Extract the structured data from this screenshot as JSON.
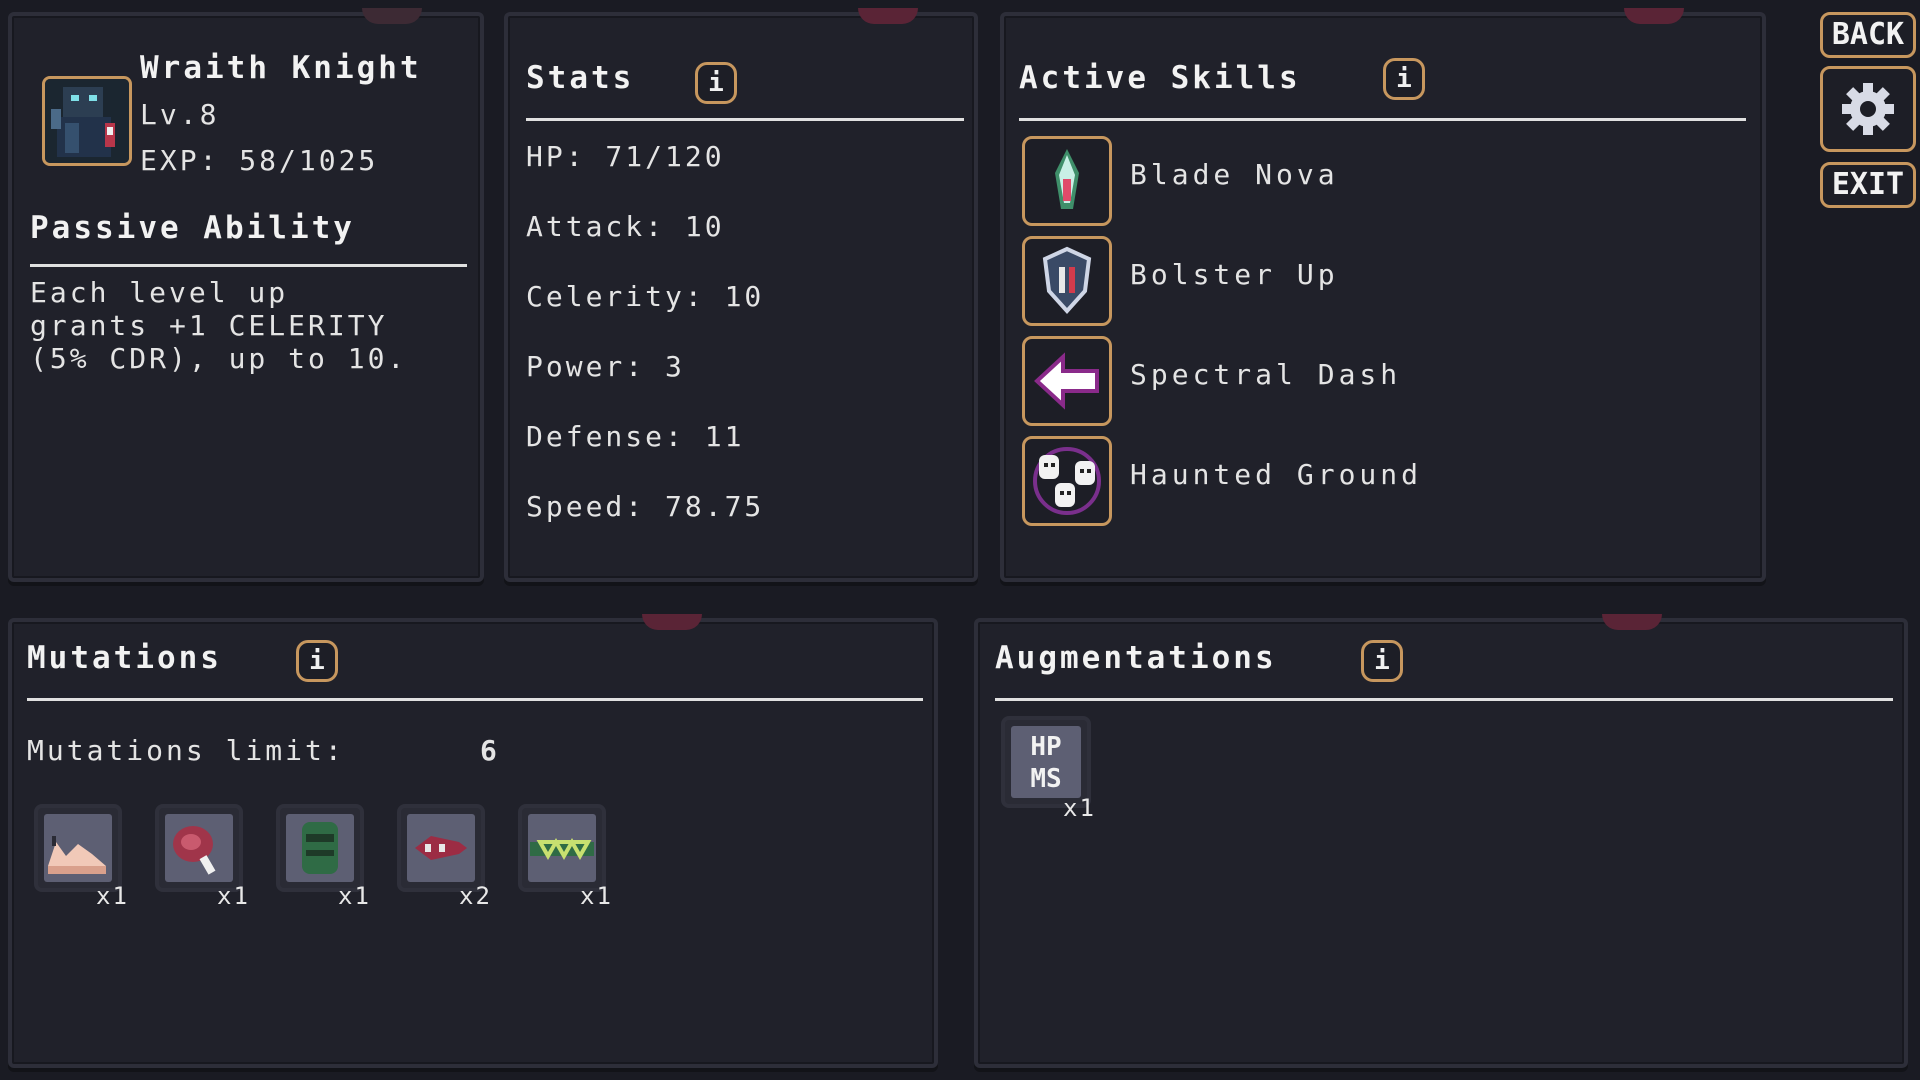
{
  "character": {
    "name": "Wraith Knight",
    "level": "Lv.8",
    "exp": "EXP: 58/1025",
    "passive_heading": "Passive Ability",
    "passive_lines": [
      "Each level up",
      "grants +1 CELERITY",
      "(5% CDR), up to 10."
    ],
    "portrait_icon": "wraith-knight-portrait"
  },
  "stats": {
    "heading": "Stats",
    "info_label": "i",
    "items": [
      "HP: 71/120",
      "Attack: 10",
      "Celerity: 10",
      "Power: 3",
      "Defense: 11",
      "Speed: 78.75"
    ]
  },
  "skills": {
    "heading": "Active Skills",
    "info_label": "i",
    "items": [
      {
        "label": "Blade Nova",
        "icon": "blade-nova-icon"
      },
      {
        "label": "Bolster Up",
        "icon": "shield-icon"
      },
      {
        "label": "Spectral Dash",
        "icon": "arrow-left-icon"
      },
      {
        "label": "Haunted Ground",
        "icon": "ghosts-icon"
      }
    ]
  },
  "mutations": {
    "heading": "Mutations",
    "info_label": "i",
    "limit_label": "Mutations limit:",
    "limit_value": "6",
    "items": [
      {
        "icon": "claw-mutation-icon",
        "count": "x1"
      },
      {
        "icon": "meat-mutation-icon",
        "count": "x1"
      },
      {
        "icon": "goblin-mutation-icon",
        "count": "x1"
      },
      {
        "icon": "fish-mutation-icon",
        "count": "x2"
      },
      {
        "icon": "chain-mutation-icon",
        "count": "x1"
      }
    ]
  },
  "augmentations": {
    "heading": "Augmentations",
    "info_label": "i",
    "items": [
      {
        "line1": "HP",
        "line2": "MS",
        "count": "x1"
      }
    ]
  },
  "side_buttons": {
    "back": "BACK",
    "settings_icon": "gear-icon",
    "exit": "EXIT"
  },
  "colors": {
    "background": "#1a1b23",
    "panel": "#20212a",
    "accent_border": "#c7975e",
    "text": "#e4e4e4"
  }
}
